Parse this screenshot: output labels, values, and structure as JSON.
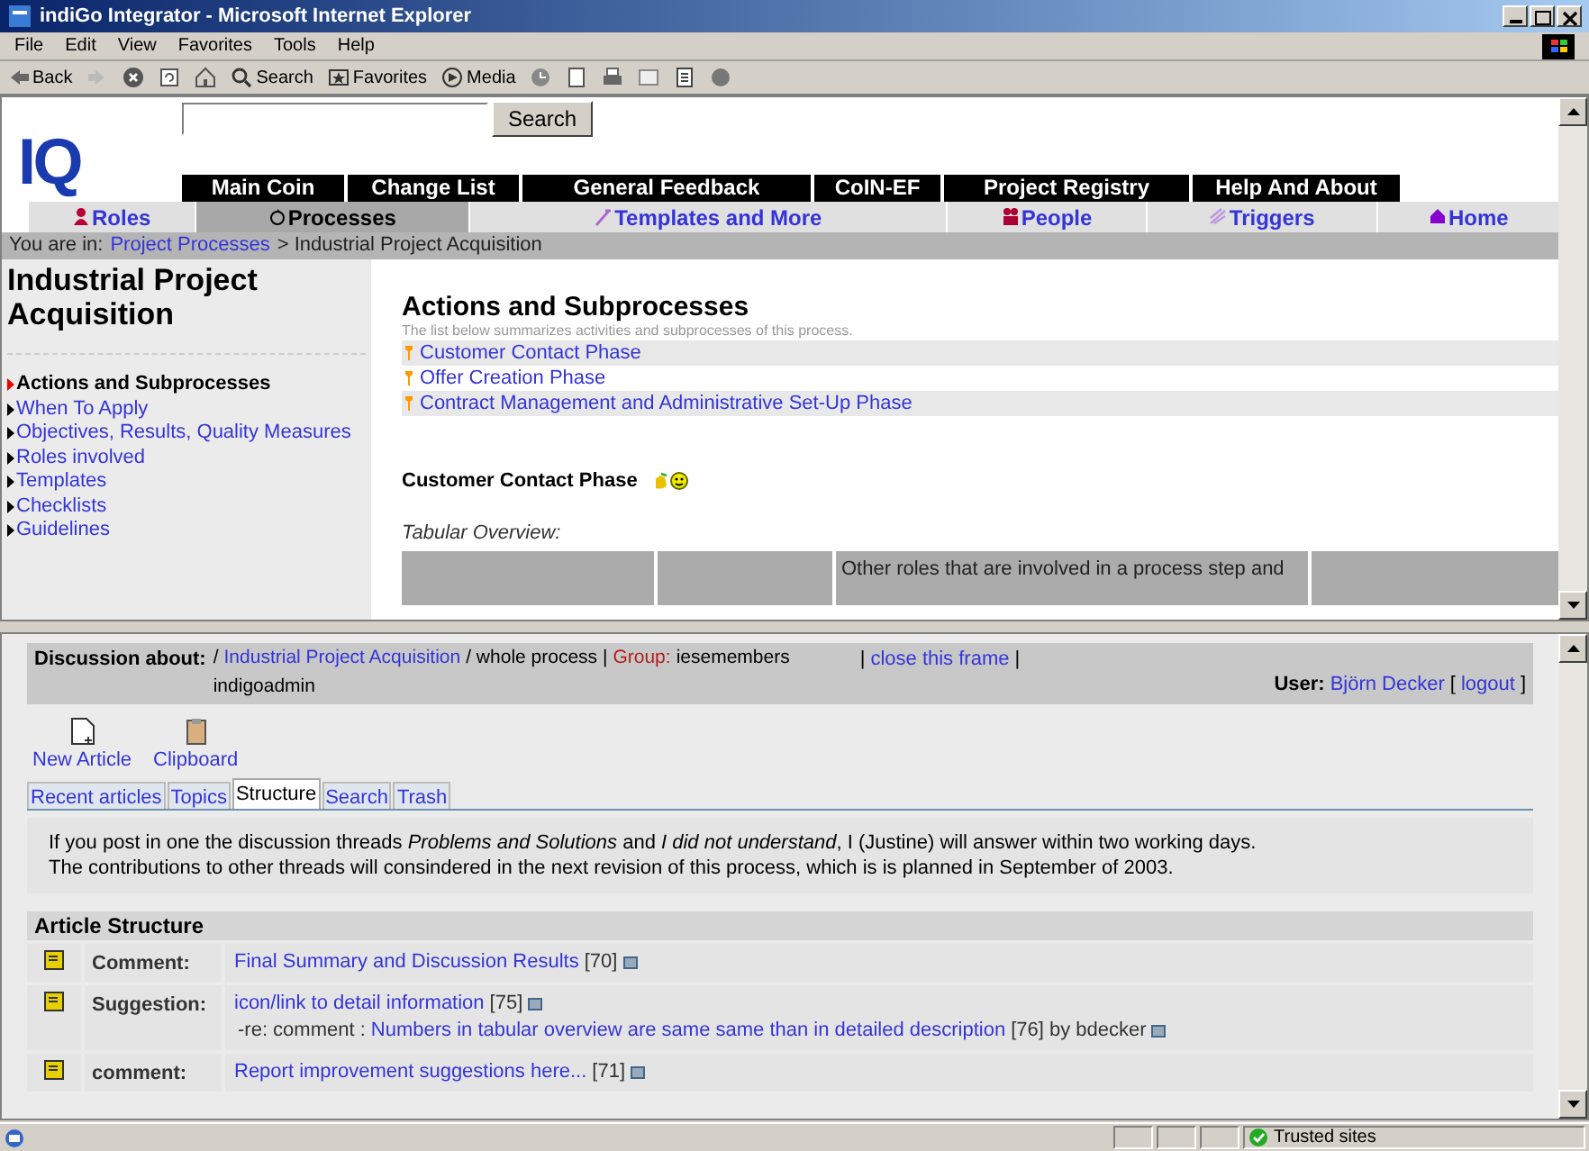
{
  "window": {
    "title": "indiGo Integrator - Microsoft Internet Explorer"
  },
  "menu": [
    "File",
    "Edit",
    "View",
    "Favorites",
    "Tools",
    "Help"
  ],
  "toolbar": [
    {
      "kind": "back",
      "label": "Back"
    },
    {
      "kind": "search",
      "label": "Search"
    },
    {
      "kind": "favorites",
      "label": "Favorites"
    },
    {
      "kind": "media",
      "label": "Media"
    }
  ],
  "top": {
    "logo": "IQ",
    "search_button": "Search",
    "nav_top": [
      "Main Coin",
      "Change List",
      "General Feedback",
      "CoIN-EF",
      "Project Registry",
      "Help And About"
    ],
    "nav_tabs": [
      {
        "label": "Roles",
        "selected": false
      },
      {
        "label": "Processes",
        "selected": true
      },
      {
        "label": "Templates and More",
        "selected": false
      },
      {
        "label": "People",
        "selected": false
      },
      {
        "label": "Triggers",
        "selected": false
      },
      {
        "label": "Home",
        "selected": false
      }
    ],
    "breadcrumb": {
      "prefix": "You are in:",
      "link": "Project Processes",
      "rest": "> Industrial Project Acquisition"
    },
    "process_title": "Industrial Project Acquisition",
    "sidebar": [
      {
        "label": "Actions and Subprocesses",
        "selected": true
      },
      {
        "label": "When To Apply",
        "selected": false
      },
      {
        "label": "Objectives, Results, Quality Measures",
        "selected": false
      },
      {
        "label": "Roles involved",
        "selected": false
      },
      {
        "label": "Templates",
        "selected": false
      },
      {
        "label": "Checklists",
        "selected": false
      },
      {
        "label": "Guidelines",
        "selected": false
      }
    ],
    "section_title": "Actions and Subprocesses",
    "section_desc": "The list below summarizes activities and subprocesses of this process.",
    "subprocesses": [
      "Customer Contact Phase",
      "Offer Creation Phase",
      "Contract Management and Administrative Set-Up Phase"
    ],
    "phase_title": "Customer Contact Phase",
    "tabular_label": "Tabular Overview:",
    "table_header": "Other roles that are involved in a process step and"
  },
  "discussion": {
    "label": "Discussion about:",
    "slash": "/",
    "topic_link": "Industrial Project Acquisition",
    "scope": "/ whole process |",
    "group_label": "Group:",
    "group": "iesemembers",
    "group_extra": "indigoadmin",
    "close_separators": [
      "|",
      "|"
    ],
    "close_link": "close this frame",
    "logout_brackets": [
      "[",
      "]"
    ],
    "user_label": "User:",
    "user": "Björn Decker",
    "logout": "logout",
    "actions": [
      {
        "kind": "new",
        "label": "New Article"
      },
      {
        "kind": "clipboard",
        "label": "Clipboard"
      }
    ],
    "tabs": [
      {
        "label": "Recent articles",
        "selected": false
      },
      {
        "label": "Topics",
        "selected": false
      },
      {
        "label": "Structure",
        "selected": true
      },
      {
        "label": "Search",
        "selected": false
      },
      {
        "label": "Trash",
        "selected": false
      }
    ],
    "notice": [
      "If you post in one the discussion threads *Problems and Solutions* and *I did not understand*, I (Justine) will answer within two working days.",
      "The contributions to other threads will consindered in the next revision of this process, which is is planned in September of 2003."
    ],
    "structure_title": "Article Structure",
    "articles": [
      {
        "type": "Comment:",
        "title": "Final Summary and Discussion Results",
        "number": "[70]"
      },
      {
        "type": "Suggestion:",
        "title": "icon/link to detail information",
        "number": "[75]",
        "reply": {
          "prefix": "-re: comment :",
          "title": "Numbers in tabular overview are same same than in detailed description",
          "number": "[76]",
          "author": "by bdecker"
        }
      },
      {
        "type": "comment:",
        "title": "Report improvement suggestions here...",
        "number": "[71]"
      }
    ]
  },
  "status": {
    "zone": "Trusted sites"
  }
}
